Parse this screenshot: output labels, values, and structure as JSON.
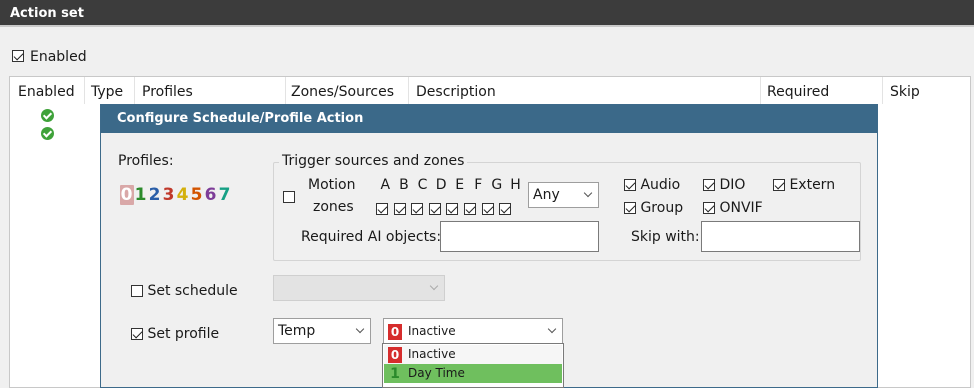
{
  "window": {
    "title": "Action set"
  },
  "enabled": {
    "label": "Enabled",
    "checked": true
  },
  "table": {
    "columns": [
      "Enabled",
      "Type",
      "Profiles",
      "Zones/Sources",
      "Description",
      "Required",
      "Skip"
    ],
    "rows": [
      {
        "enabled": true
      },
      {
        "enabled": true
      }
    ]
  },
  "dialog": {
    "title": "Configure Schedule/Profile Action",
    "profiles": {
      "label": "Profiles:",
      "digits": [
        "0",
        "1",
        "2",
        "3",
        "4",
        "5",
        "6",
        "7"
      ],
      "colors": [
        "#d9a8a8",
        "#2b8a2b",
        "#2a5ea8",
        "#c0392b",
        "#d4b00c",
        "#d35400",
        "#7d3c98",
        "#16a085"
      ]
    },
    "trigger": {
      "label": "Trigger sources and zones",
      "motion_label_1": "Motion",
      "motion_label_2": "zones",
      "motion_checked": false,
      "zone_letters": [
        "A",
        "B",
        "C",
        "D",
        "E",
        "F",
        "G",
        "H"
      ],
      "zone_checked": [
        true,
        true,
        true,
        true,
        true,
        true,
        true,
        true
      ],
      "mode_select": "Any",
      "audio": "Audio",
      "dio": "DIO",
      "extern": "Extern",
      "group": "Group",
      "onvif": "ONVIF",
      "required_ai_label": "Required AI objects:",
      "required_ai_value": "",
      "skip_with_label": "Skip with:",
      "skip_with_value": ""
    },
    "schedule": {
      "label": "Set schedule",
      "checked": false,
      "value": ""
    },
    "profile": {
      "label": "Set profile",
      "checked": true,
      "type_select": "Temp",
      "profile_select_badge": "0",
      "profile_select_value": "Inactive",
      "options": [
        {
          "badge": "0",
          "label": "Inactive"
        },
        {
          "badge": "1",
          "label": "Day Time"
        }
      ]
    }
  }
}
